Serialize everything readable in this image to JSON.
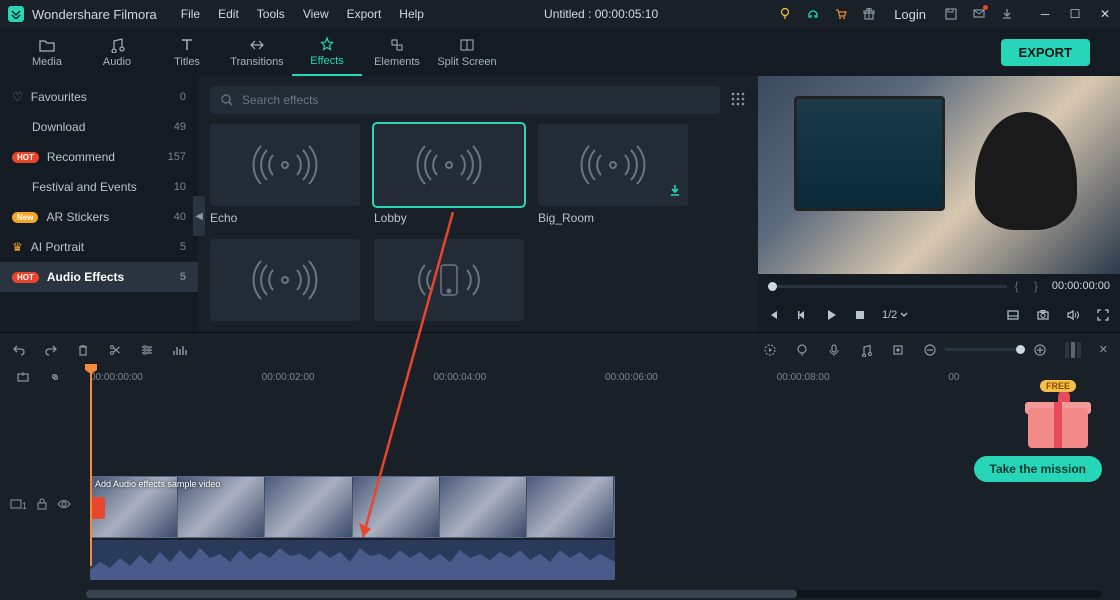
{
  "titlebar": {
    "app_name": "Wondershare Filmora",
    "menus": [
      "File",
      "Edit",
      "Tools",
      "View",
      "Export",
      "Help"
    ],
    "project_title": "Untitled : 00:00:05:10",
    "login": "Login"
  },
  "maintabs": {
    "items": [
      "Media",
      "Audio",
      "Titles",
      "Transitions",
      "Effects",
      "Elements",
      "Split Screen"
    ],
    "active": "Effects",
    "export_btn": "EXPORT"
  },
  "sidebar": {
    "items": [
      {
        "label": "Favourites",
        "count": "0",
        "kind": "fav"
      },
      {
        "label": "Download",
        "count": "49",
        "kind": "plain"
      },
      {
        "label": "Recommend",
        "count": "157",
        "kind": "hot"
      },
      {
        "label": "Festival and Events",
        "count": "10",
        "kind": "plain"
      },
      {
        "label": "AR Stickers",
        "count": "40",
        "kind": "new"
      },
      {
        "label": "AI Portrait",
        "count": "5",
        "kind": "crown"
      },
      {
        "label": "Audio Effects",
        "count": "5",
        "kind": "hot",
        "selected": true
      }
    ]
  },
  "effects": {
    "search_placeholder": "Search effects",
    "cards": [
      {
        "label": "Echo"
      },
      {
        "label": "Lobby",
        "selected": true
      },
      {
        "label": "Big_Room",
        "download": true
      },
      {
        "label": ""
      },
      {
        "label": "",
        "phone": true
      }
    ]
  },
  "preview": {
    "time": "00:00:00:00",
    "ratio": "1/2"
  },
  "timeline": {
    "ruler": [
      "00:00:00:00",
      "00:00:02:00",
      "00:00:04:00",
      "00:00:06:00",
      "00:00:08:00",
      "00"
    ],
    "clip_label": "Add Audio effects sample video",
    "track_head": "1"
  },
  "annotations": {
    "mission_btn": "Take the mission",
    "free_badge": "FREE"
  }
}
